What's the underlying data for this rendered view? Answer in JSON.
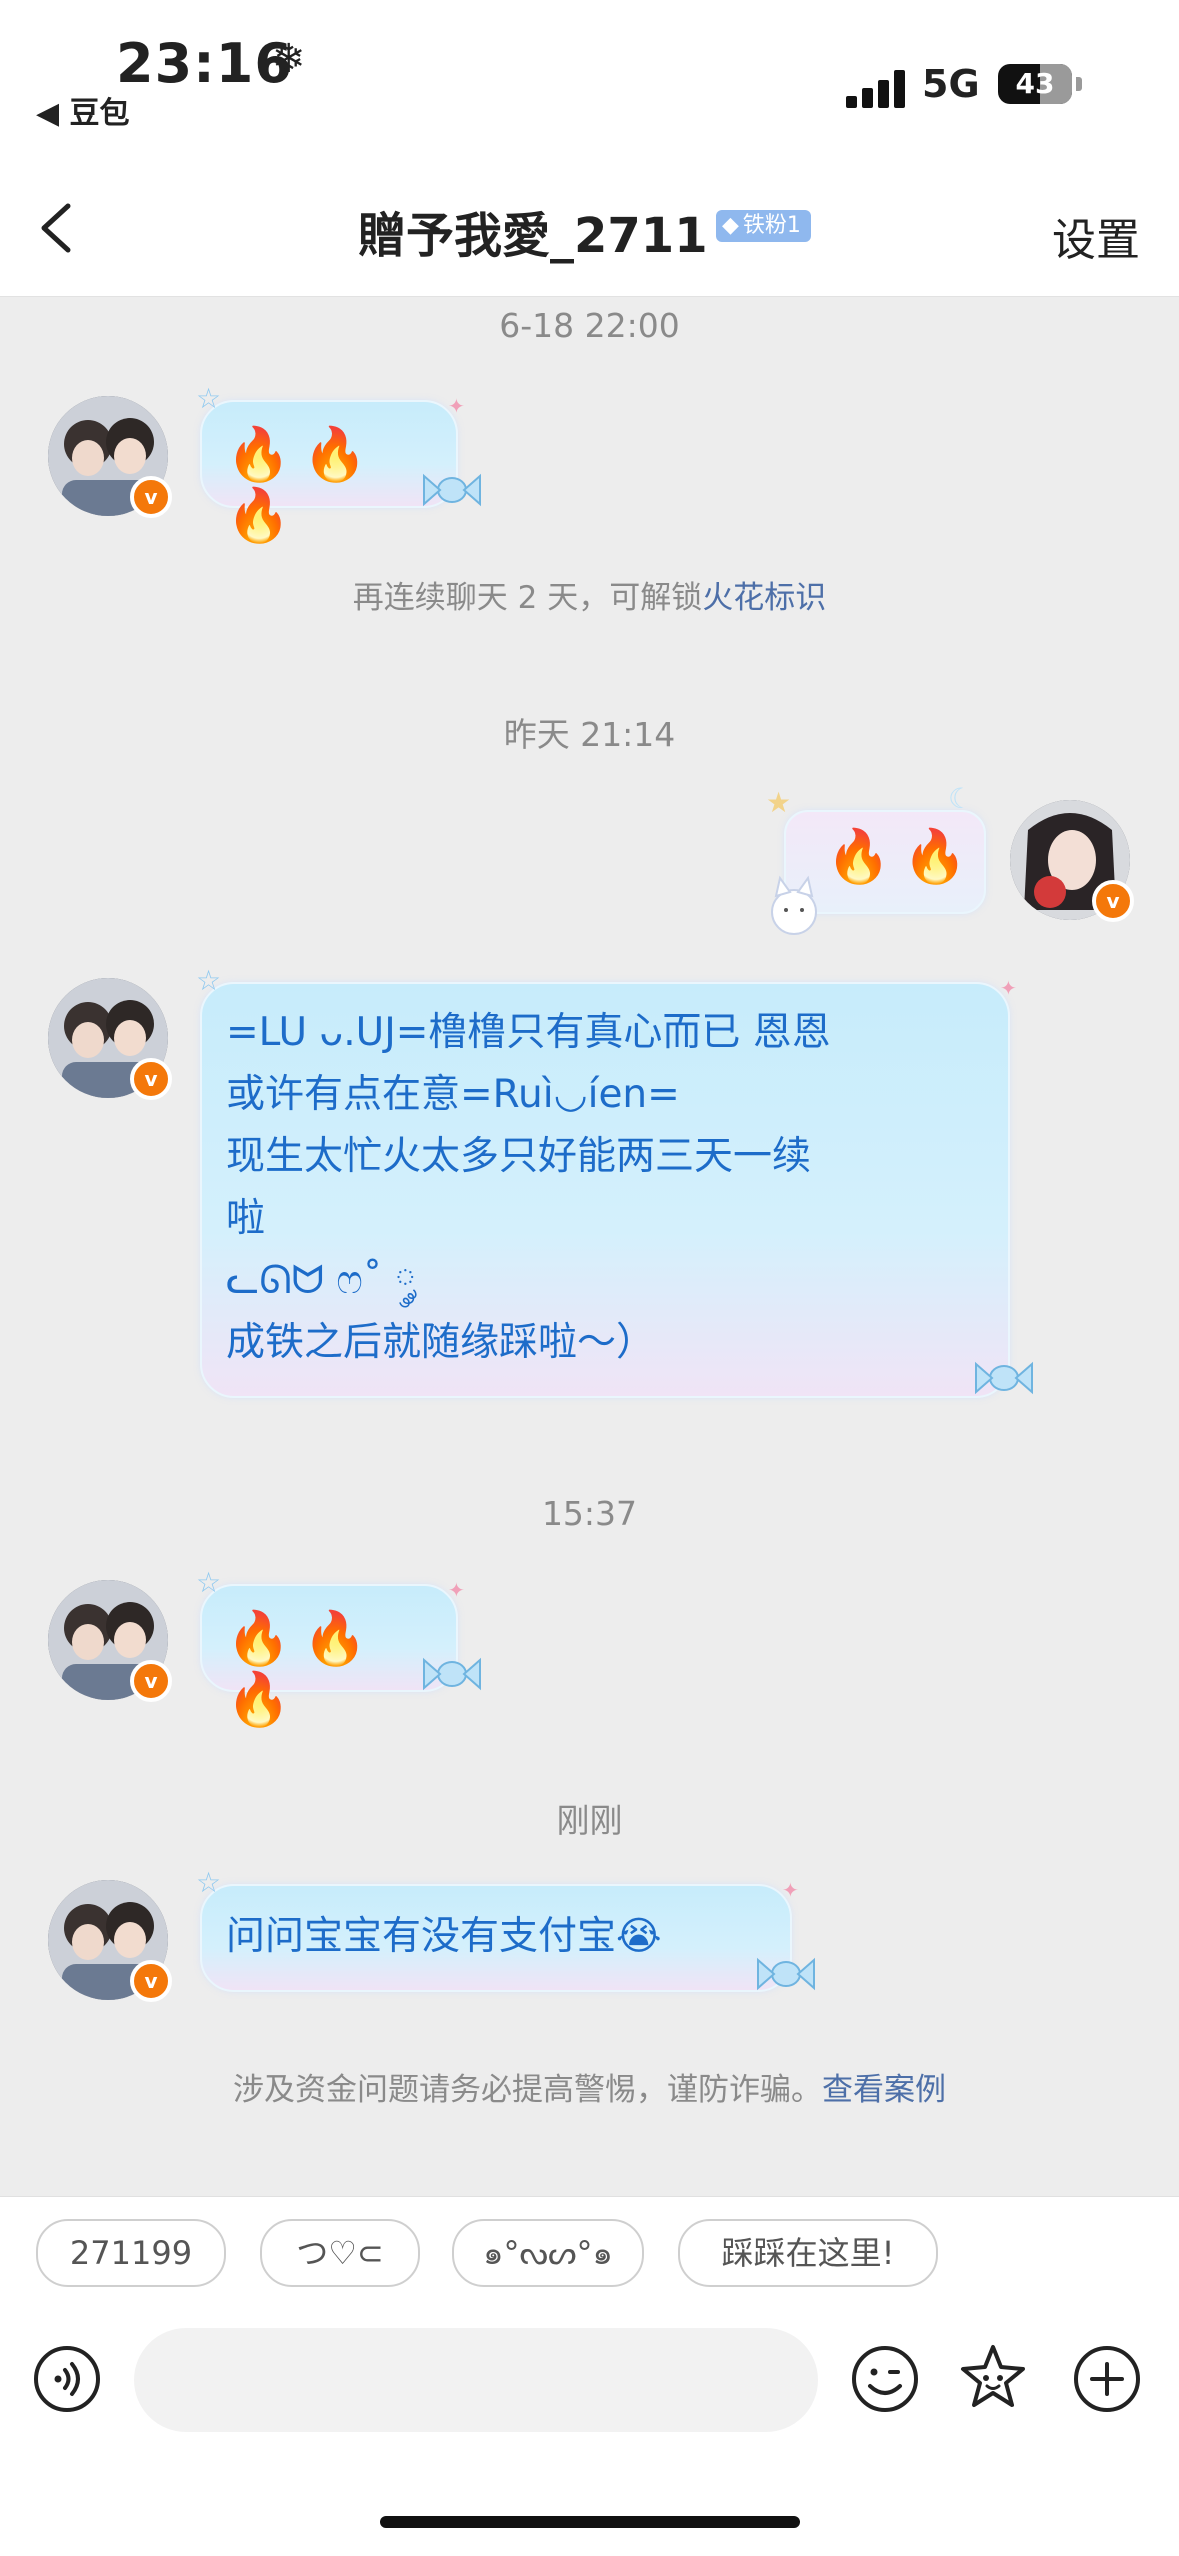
{
  "status": {
    "time": "23:16",
    "back_app": "豆包",
    "network": "5G",
    "battery": "43"
  },
  "header": {
    "title": "贈予我愛_2711",
    "badge": "铁粉1",
    "settings": "设置"
  },
  "messages": {
    "t1": "6-18 22:00",
    "m1": "🔥🔥🔥",
    "notice1_prefix": "再连续聊天 2 天，可解锁",
    "notice1_link": "火花标识",
    "t2": "昨天 21:14",
    "m2": "🔥🔥",
    "m3": "=LU ᴗ.UJ=橹橹只有真心而已 恩恩\n或许有点在意=Ruì◡íen=\n现生太忙火太多只好能两三天一续\n啦\nᓚᘏᗢ ෆ˚ ༘\n成铁之后就随缘踩啦～）",
    "t3": "15:37",
    "m4": "🔥🔥🔥",
    "t4": "刚刚",
    "m5": "问问宝宝有没有支付宝😭",
    "notice2_prefix": "涉及资金问题请务必提高警惕，谨防诈骗。",
    "notice2_link": "查看案例"
  },
  "quick_replies": [
    "271199",
    "つ♡⊂",
    "๑°ᔓᔕ°๑",
    "踩踩在这里!"
  ],
  "icons": {
    "back": "chevron-left-icon",
    "voice": "voice-icon",
    "emoji": "emoji-icon",
    "sticker": "star-sticker-icon",
    "add": "plus-icon"
  },
  "colors": {
    "link": "#4d6fa8",
    "bubble_text": "#1d6cc9",
    "badge": "#8fb8ee",
    "verified": "#f4780a"
  }
}
